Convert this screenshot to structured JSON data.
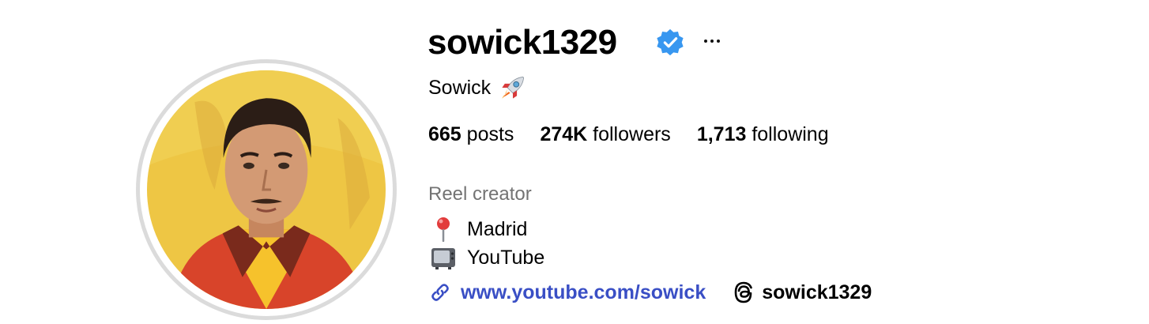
{
  "profile": {
    "username": "sowick1329",
    "verified": true,
    "full_name": "Sowick",
    "full_name_emoji_icon": "rocket-icon",
    "avatar_description_icon": "profile-photo",
    "category": "Reel creator"
  },
  "stats": {
    "posts": {
      "count": "665",
      "label": "posts"
    },
    "followers": {
      "count": "274K",
      "label": "followers"
    },
    "following": {
      "count": "1,713",
      "label": "following"
    }
  },
  "bio": {
    "line1": {
      "icon": "round-pushpin-icon",
      "text": "Madrid"
    },
    "line2": {
      "icon": "television-icon",
      "text": "YouTube"
    }
  },
  "links": {
    "website": {
      "icon": "link-icon",
      "text": "www.youtube.com/sowick"
    },
    "threads": {
      "icon": "threads-icon",
      "text": "sowick1329"
    }
  },
  "colors": {
    "verified_badge": "#3897f0",
    "link": "#3a4fc5",
    "category": "#737373",
    "avatar_ring": "#dbdbdb",
    "avatar_bg": "#f0c64a"
  }
}
